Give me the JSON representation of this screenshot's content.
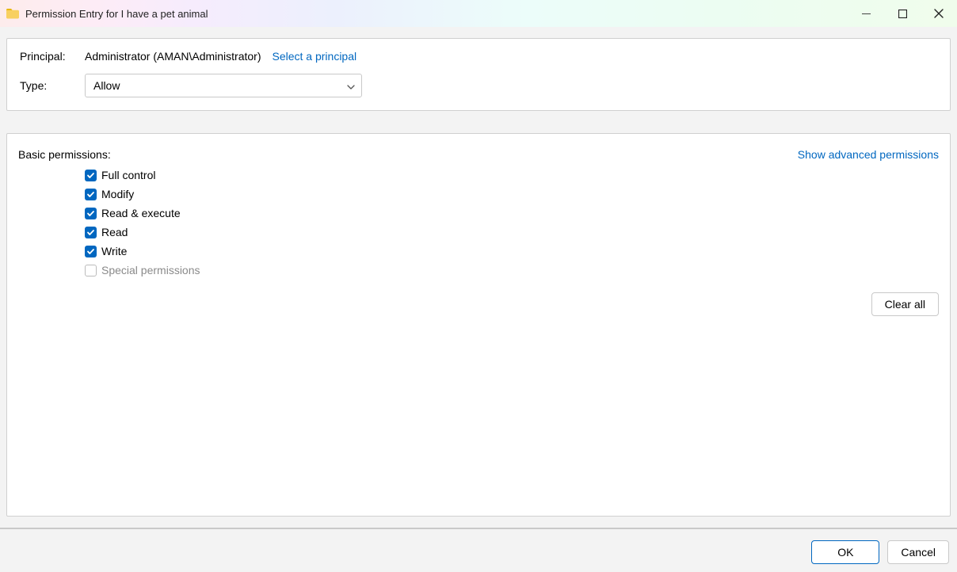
{
  "window": {
    "title": "Permission Entry for I have a pet animal"
  },
  "header": {
    "principal_label": "Principal:",
    "principal_value": "Administrator (AMAN\\Administrator)",
    "select_principal": "Select a principal",
    "type_label": "Type:",
    "type_value": "Allow"
  },
  "permissions": {
    "section_label": "Basic permissions:",
    "show_advanced": "Show advanced permissions",
    "items": [
      {
        "label": "Full control",
        "checked": true,
        "disabled": false
      },
      {
        "label": "Modify",
        "checked": true,
        "disabled": false
      },
      {
        "label": "Read & execute",
        "checked": true,
        "disabled": false
      },
      {
        "label": "Read",
        "checked": true,
        "disabled": false
      },
      {
        "label": "Write",
        "checked": true,
        "disabled": false
      },
      {
        "label": "Special permissions",
        "checked": false,
        "disabled": true
      }
    ],
    "clear_all": "Clear all"
  },
  "footer": {
    "ok": "OK",
    "cancel": "Cancel"
  }
}
